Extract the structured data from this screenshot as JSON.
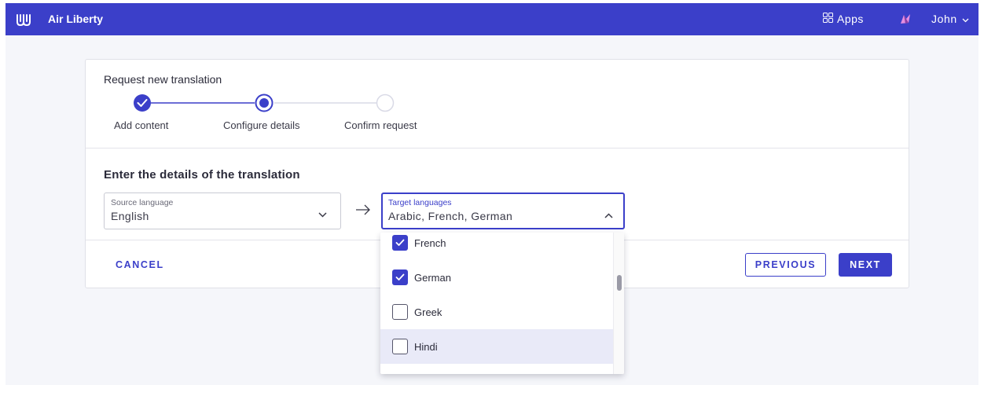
{
  "app": {
    "brand": "Air Liberty",
    "apps_label": "Apps",
    "user_name": "John",
    "accent_color": "#3b3fc9"
  },
  "card": {
    "title": "Request new translation",
    "steps": [
      {
        "label": "Add content",
        "state": "complete"
      },
      {
        "label": "Configure details",
        "state": "current"
      },
      {
        "label": "Confirm request",
        "state": "upcoming"
      }
    ],
    "section_title": "Enter the details of the translation",
    "source": {
      "label": "Source language",
      "value": "English"
    },
    "target": {
      "label": "Target languages",
      "value": "Arabic, French, German"
    },
    "cancel_label": "CANCEL",
    "previous_label": "PREVIOUS",
    "next_label": "NEXT"
  },
  "dropdown": {
    "options": [
      {
        "label": "French",
        "checked": true
      },
      {
        "label": "German",
        "checked": true
      },
      {
        "label": "Greek",
        "checked": false
      },
      {
        "label": "Hindi",
        "checked": false,
        "hovered": true
      }
    ]
  }
}
